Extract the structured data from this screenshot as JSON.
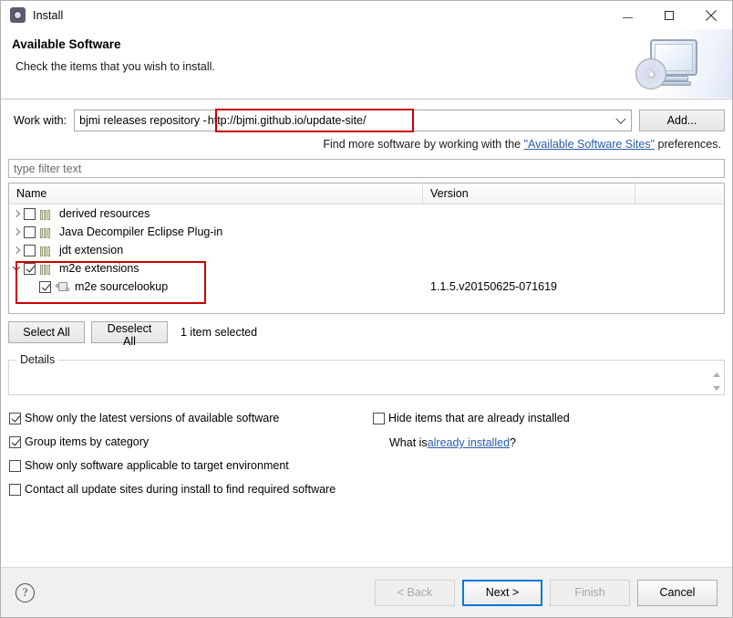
{
  "window": {
    "title": "Install",
    "icon": "install-gear-icon",
    "controls": {
      "minimize": "–",
      "maximize": "□",
      "close": "×"
    }
  },
  "banner": {
    "title": "Available Software",
    "subtitle": "Check the items that you wish to install.",
    "icon": "monitor-cd-icon"
  },
  "work_with": {
    "label": "Work with:",
    "value_prefix": "bjmi releases repository -",
    "value_url": "http://bjmi.github.io/update-site/",
    "add_button": "Add...",
    "highlight_color": "#cc0000"
  },
  "hint": {
    "before": "Find more software by working with the ",
    "link": "\"Available Software Sites\"",
    "after": " preferences."
  },
  "filter": {
    "placeholder": "type filter text",
    "value": ""
  },
  "tree": {
    "columns": {
      "name": "Name",
      "version": "Version"
    },
    "rows": [
      {
        "name": "derived resources",
        "version": "",
        "checked": false,
        "expanded": false,
        "has_twisty": true,
        "level": 0,
        "icon": "category-icon"
      },
      {
        "name": "Java Decompiler Eclipse Plug-in",
        "version": "",
        "checked": false,
        "expanded": false,
        "has_twisty": true,
        "level": 0,
        "icon": "category-icon"
      },
      {
        "name": "jdt extension",
        "version": "",
        "checked": false,
        "expanded": false,
        "has_twisty": true,
        "level": 0,
        "icon": "category-icon"
      },
      {
        "name": "m2e extensions",
        "version": "",
        "checked": true,
        "expanded": true,
        "has_twisty": true,
        "level": 0,
        "icon": "category-icon"
      },
      {
        "name": "m2e sourcelookup",
        "version": "1.1.5.v20150625-071619",
        "checked": true,
        "expanded": false,
        "has_twisty": false,
        "level": 1,
        "icon": "plugin-icon"
      }
    ]
  },
  "selection_bar": {
    "select_all": "Select All",
    "deselect_all": "Deselect All",
    "count_text": "1 item selected"
  },
  "details": {
    "legend": "Details",
    "content": ""
  },
  "options": {
    "left": [
      {
        "label": "Show only the latest versions of available software",
        "checked": true
      },
      {
        "label": "Group items by category",
        "checked": true
      },
      {
        "label": "Show only software applicable to target environment",
        "checked": false
      },
      {
        "label": "Contact all update sites during install to find required software",
        "checked": false
      }
    ],
    "right": [
      {
        "label": "Hide items that are already installed",
        "checked": false
      }
    ],
    "what_is": {
      "before": "What is ",
      "link": "already installed",
      "after": "?"
    }
  },
  "footer": {
    "help_glyph": "?",
    "buttons": [
      {
        "label": "< Back",
        "state": "disabled"
      },
      {
        "label": "Next >",
        "state": "default"
      },
      {
        "label": "Finish",
        "state": "disabled"
      },
      {
        "label": "Cancel",
        "state": "enabled"
      }
    ]
  }
}
